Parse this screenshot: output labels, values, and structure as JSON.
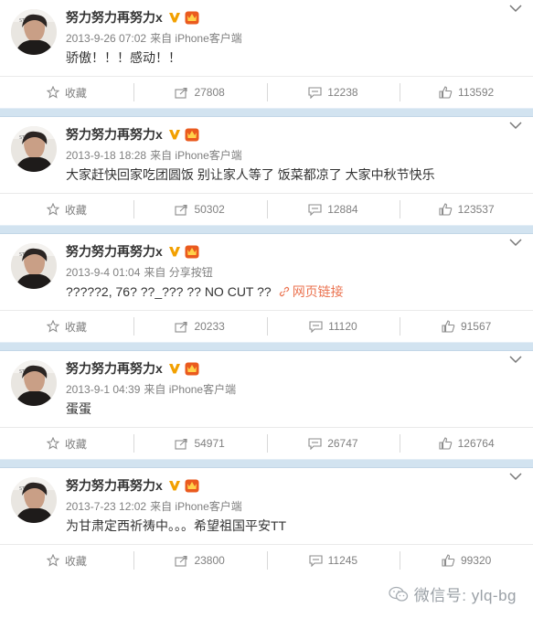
{
  "colors": {
    "separator": "#d2e3f0",
    "link": "#eb7350",
    "meta": "#808080",
    "verified": "#f2a000",
    "member": "#ea5a1e"
  },
  "posts": [
    {
      "username": "努力努力再努力x",
      "time": "2013-9-26 07:02",
      "source": "来自 iPhone客户端",
      "text": "骄傲！！！感动！！",
      "link_text": "",
      "favorite_label": "收藏",
      "reposts": "27808",
      "comments": "12238",
      "likes": "113592"
    },
    {
      "username": "努力努力再努力x",
      "time": "2013-9-18 18:28",
      "source": "来自 iPhone客户端",
      "text": "大家赶快回家吃团圆饭 别让家人等了 饭菜都凉了 大家中秋节快乐",
      "link_text": "",
      "favorite_label": "收藏",
      "reposts": "50302",
      "comments": "12884",
      "likes": "123537"
    },
    {
      "username": "努力努力再努力x",
      "time": "2013-9-4 01:04",
      "source": "来自 分享按钮",
      "text": "?????2, 76? ??_??? ?? NO CUT ??",
      "link_text": "网页链接",
      "favorite_label": "收藏",
      "reposts": "20233",
      "comments": "11120",
      "likes": "91567"
    },
    {
      "username": "努力努力再努力x",
      "time": "2013-9-1 04:39",
      "source": "来自 iPhone客户端",
      "text": "蛋蛋",
      "link_text": "",
      "favorite_label": "收藏",
      "reposts": "54971",
      "comments": "26747",
      "likes": "126764"
    },
    {
      "username": "努力努力再努力x",
      "time": "2013-7-23 12:02",
      "source": "来自 iPhone客户端",
      "text": "为甘肃定西祈祷中。。。希望祖国平安TT",
      "link_text": "",
      "favorite_label": "收藏",
      "reposts": "23800",
      "comments": "11245",
      "likes": "99320"
    }
  ],
  "watermark": "微信号: ylq-bg"
}
